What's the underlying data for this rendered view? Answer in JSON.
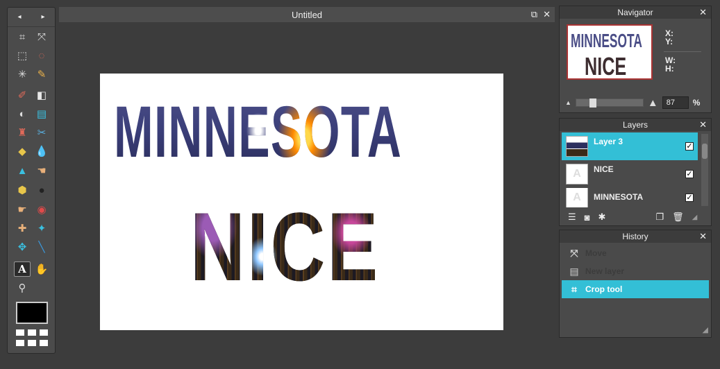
{
  "toolbox": {
    "nav_left": "◂",
    "nav_right": "▸",
    "tools": [
      {
        "name": "crop-icon",
        "glyph": "⌗"
      },
      {
        "name": "move-icon",
        "glyph": "⤧"
      },
      {
        "name": "marquee-icon",
        "glyph": "⬚"
      },
      {
        "name": "lasso-icon",
        "glyph": "◌"
      },
      {
        "name": "magic-wand-icon",
        "glyph": "✳"
      },
      {
        "name": "pencil-icon",
        "glyph": "✎"
      },
      {
        "name": "brush-icon",
        "glyph": "✐"
      },
      {
        "name": "eraser-icon",
        "glyph": "◧"
      },
      {
        "name": "paint-bucket-icon",
        "glyph": "◐"
      },
      {
        "name": "gradient-icon",
        "glyph": "▤"
      },
      {
        "name": "stamp-icon",
        "glyph": "♜"
      },
      {
        "name": "color-replace-icon",
        "glyph": "✂"
      },
      {
        "name": "drawing-icon",
        "glyph": "◆"
      },
      {
        "name": "blur-icon",
        "glyph": "💧"
      },
      {
        "name": "sharpen-icon",
        "glyph": "▲"
      },
      {
        "name": "smudge-icon",
        "glyph": "☚"
      },
      {
        "name": "sponge-icon",
        "glyph": "⬢"
      },
      {
        "name": "dodge-icon",
        "glyph": "●"
      },
      {
        "name": "burn-icon",
        "glyph": "☛"
      },
      {
        "name": "red-eye-icon",
        "glyph": "◉"
      },
      {
        "name": "spot-heal-icon",
        "glyph": "✚"
      },
      {
        "name": "bloat-icon",
        "glyph": "✦"
      },
      {
        "name": "pinch-icon",
        "glyph": "✥"
      },
      {
        "name": "color-picker-icon",
        "glyph": "╲"
      },
      {
        "name": "type-icon",
        "glyph": "A"
      },
      {
        "name": "hand-icon",
        "glyph": "✋"
      },
      {
        "name": "zoom-icon",
        "glyph": "⚲"
      }
    ]
  },
  "document": {
    "title": "Untitled",
    "restore_icon": "⧉",
    "close_icon": "✕",
    "canvas_text_1": "MINNESOTA",
    "canvas_text_2": "NICE"
  },
  "navigator": {
    "title": "Navigator",
    "close": "✕",
    "thumb_text_1": "MINNESOTA",
    "thumb_text_2": "NICE",
    "x_label": "X:",
    "y_label": "Y:",
    "w_label": "W:",
    "h_label": "H:",
    "zoom_small_icon": "▲",
    "zoom_large_icon": "▲",
    "zoom_value": "87",
    "zoom_unit": "%",
    "zoom_level_fraction": 0.22
  },
  "layers": {
    "title": "Layers",
    "close": "✕",
    "items": [
      {
        "name": "Layer 3",
        "check": "✓"
      },
      {
        "name": "NICE",
        "check": "✓"
      },
      {
        "name": "MINNESOTA",
        "check": "✓"
      }
    ],
    "footer": {
      "adjust_icon": "☰",
      "mask_icon": "◙",
      "fx_icon": "✱",
      "new_icon": "❐",
      "delete_icon": "🗑",
      "resize_icon": "◢"
    }
  },
  "history": {
    "title": "History",
    "close": "✕",
    "items": [
      {
        "label": "Move",
        "icon": "⤧"
      },
      {
        "label": "New layer",
        "icon": "▤"
      },
      {
        "label": "Crop tool",
        "icon": "⌗"
      }
    ],
    "resize_icon": "◢"
  },
  "colors": {
    "accent": "#33bfd6",
    "foreground_color": "#000000"
  }
}
